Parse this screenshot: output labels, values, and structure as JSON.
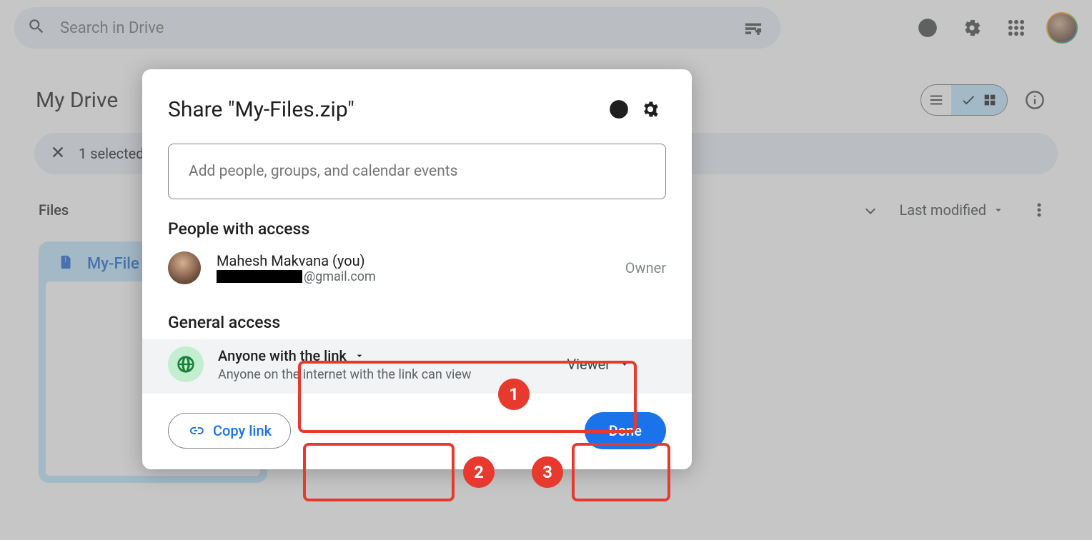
{
  "search": {
    "placeholder": "Search in Drive"
  },
  "page": {
    "title": "My Drive"
  },
  "selection": {
    "text": "1 selected"
  },
  "list": {
    "section_label": "Files",
    "sort_label": "Last modified"
  },
  "file": {
    "name": "My-Files.zip",
    "display": "My-File"
  },
  "dialog": {
    "title": "Share \"My-Files.zip\"",
    "add_people_placeholder": "Add people, groups, and calendar events",
    "people_section": "People with access",
    "person": {
      "name": "Mahesh Makvana (you)",
      "email_suffix": "@gmail.com",
      "role": "Owner"
    },
    "general_access_section": "General access",
    "general_access": {
      "mode": "Anyone with the link",
      "description": "Anyone on the internet with the link can view",
      "role": "Viewer"
    },
    "copy_link": "Copy link",
    "done": "Done"
  },
  "annotations": {
    "n1": "1",
    "n2": "2",
    "n3": "3"
  }
}
